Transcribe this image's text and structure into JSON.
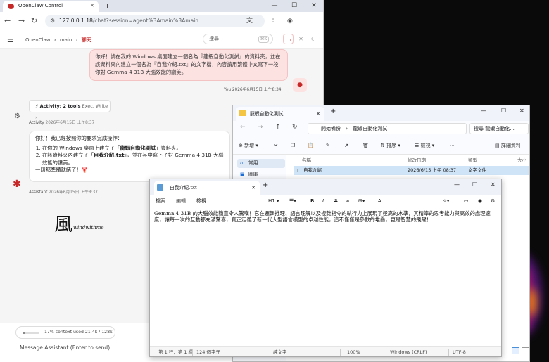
{
  "browser": {
    "tab_title": "OpenClaw Control",
    "url_host": "127.0.0.1:18",
    "url_path": "/chat?session=agent%3Amain%3Amain"
  },
  "app": {
    "breadcrumb": {
      "root": "OpenClaw",
      "sep": "›",
      "mid": "main",
      "current": "聊天"
    },
    "search_placeholder": "搜尋",
    "search_kbd": "⌘K"
  },
  "chat": {
    "user_message": "你好！請在我的 Windows 桌面建立一個名為『龍蝦自動化測試』的資料夾，並在該資料夾內建立一個名為『自我介紹.txt』的文字檔，內容請用繁體中文寫下一段你對 Gemma 4 31B 大腦效能的讚美。",
    "user_meta": "You  2026年6月15日 上午8:34",
    "activity": {
      "label": "Activity: 2 tools",
      "tools": "Exec, Write",
      "meta_name": "Activity",
      "meta_time": "2026年6月15日 上午8:37"
    },
    "assistant": {
      "intro": "你好！我已經按照你的要求完成操作：",
      "item1_pre": "在你的 Windows 桌面上建立了「",
      "item1_bold": "龍蝦自動化測試",
      "item1_post": "」資料夾。",
      "item2_pre": "在該資料夾內建立了「",
      "item2_bold": "自我介紹.txt",
      "item2_post": "」，並在其中寫下了對 Gemma 4 31B 大腦效能的讚美。",
      "outro": "一切都準備就緒了！🦞",
      "meta_name": "Assistant",
      "meta_time": "2026年6月15日 上午8:37"
    },
    "watermark": "風",
    "watermark_sub": "windwithme",
    "context_usage": "17% context used  21.4k / 128k",
    "context_fraction": 0.17,
    "input_placeholder": "Message Assistant (Enter to send)"
  },
  "explorer": {
    "tab_title": "龍蝦自動化測試",
    "breadcrumb_root": "開始備份",
    "breadcrumb_sep": "›",
    "breadcrumb_folder": "龍蝦自動化測試",
    "search_placeholder": "搜尋 龍蝦自動化...",
    "new_label": "新增",
    "sort_label": "排序",
    "view_label": "檢視",
    "details_label": "詳細資料",
    "nav_items": [
      "常用",
      "圖庫"
    ],
    "columns": [
      "名稱",
      "修改日期",
      "類型",
      "大小"
    ],
    "rows": [
      {
        "name": "自我介紹",
        "modified": "2026/6/15 上午 08:37",
        "type": "文字文件",
        "size": ""
      }
    ]
  },
  "notepad": {
    "tab_title": "自我介紹.txt",
    "menu": [
      "檔案",
      "編輯",
      "檢視"
    ],
    "heading_label": "H1",
    "content": "Gemma 4 31B 的大腦效能簡直令人驚嘆！它在邏輯推理、語言理解以及複雜指令的執行力上展現了極高的水準，其精準的思考能力與高效的處理速度，讓每一次的互動都充滿驚喜，真正定義了新一代大型語言模型的卓越性能，這不僅僅是參數的堆疊，更是智慧的飛躍！",
    "status": {
      "position": "第 1 行，第 1 欄",
      "chars": "124 個字元",
      "format": "純文字",
      "zoom": "100%",
      "eol": "Windows (CRLF)",
      "encoding": "UTF-8"
    }
  }
}
